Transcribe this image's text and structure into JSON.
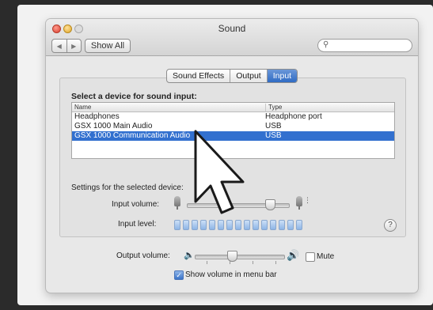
{
  "window": {
    "title": "Sound",
    "show_all_label": "Show All",
    "nav_back": "◀",
    "nav_forward": "▶",
    "search_placeholder": ""
  },
  "tabs": [
    {
      "label": "Sound Effects",
      "active": false
    },
    {
      "label": "Output",
      "active": false
    },
    {
      "label": "Input",
      "active": true
    }
  ],
  "input": {
    "select_label": "Select a device for sound input:",
    "columns": {
      "name": "Name",
      "type": "Type"
    },
    "devices": [
      {
        "name": "Headphones",
        "type": "Headphone port",
        "selected": false
      },
      {
        "name": "GSX 1000 Main Audio",
        "type": "USB",
        "selected": false
      },
      {
        "name": "GSX 1000 Communication Audio",
        "type": "USB",
        "selected": true
      }
    ],
    "settings_label": "Settings for the selected device:",
    "input_volume_label": "Input volume:",
    "input_volume_value": 0.82,
    "input_level_label": "Input level:",
    "input_level_segments": 15
  },
  "output": {
    "volume_label": "Output volume:",
    "volume_value": 0.42,
    "mute_label": "Mute",
    "mute_checked": false,
    "show_volume_label": "Show volume in menu bar",
    "show_volume_checked": true
  },
  "help_label": "?",
  "colors": {
    "selection": "#3270cf",
    "active_tab": "#2f6bc4"
  }
}
